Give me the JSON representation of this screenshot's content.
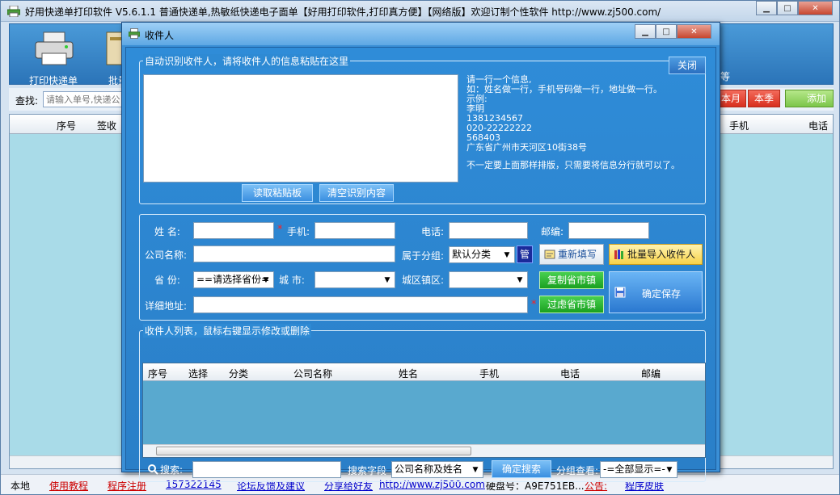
{
  "main_window": {
    "title": "好用快递单打印软件 V5.6.1.1 普通快递单,热敏纸快递电子面单【好用打印软件,打印真方便】【网络版】欢迎订制个性软件  http://www.zj500.com/",
    "min_label": "▁",
    "max_label": "□",
    "close_label": "✕"
  },
  "toolbar": {
    "items": [
      {
        "label": "打印快递单",
        "icon": "printer-icon"
      },
      {
        "label": "批量",
        "icon": "batch-icon"
      }
    ],
    "overflow_label": "等"
  },
  "search_bar": {
    "label": "查找:",
    "placeholder": "请输入单号,快递公",
    "btn_month": "本月",
    "btn_quarter": "本季",
    "btn_add": "添加"
  },
  "main_grid": {
    "columns": [
      "序号",
      "签收",
      "手机",
      "电话"
    ]
  },
  "statusbar": {
    "items": [
      {
        "text": "本地",
        "style": "plain"
      },
      {
        "text": "使用教程",
        "style": "red"
      },
      {
        "text": "程序注册",
        "style": "red"
      },
      {
        "text": "157322145",
        "style": "link"
      },
      {
        "text": "论坛反馈及建议",
        "style": "link"
      },
      {
        "text": "分享给好友",
        "style": "link"
      },
      {
        "text": "http://www.zj500.com",
        "style": "link"
      },
      {
        "text": "硬盘号：A9E751EB...",
        "style": "plain"
      },
      {
        "text": "公告:",
        "style": "red"
      },
      {
        "text": "程序皮肤",
        "style": "link"
      }
    ]
  },
  "dialog": {
    "title": "收件人",
    "recognize_group": {
      "legend": "自动识别收件人，请将收件人的信息粘贴在这里",
      "textarea_value": "",
      "close_btn": "关闭",
      "read_clipboard_btn": "读取粘贴板",
      "clear_btn": "清空识别内容",
      "help_lines": [
        "请一行一个信息,",
        "如：姓名做一行，手机号码做一行，地址做一行。",
        "示例:",
        "李明",
        "1381234567",
        "020-22222222",
        "568403",
        "广东省广州市天河区10街38号",
        "",
        "不一定要上面那样排版，只需要将信息分行就可以了。"
      ]
    },
    "form": {
      "name_label": "姓    名:",
      "name_value": "",
      "mobile_label": "手机:",
      "mobile_value": "",
      "phone_label": "电话:",
      "phone_value": "",
      "zip_label": "邮编:",
      "zip_value": "",
      "company_label": "公司名称:",
      "company_value": "",
      "group_label": "属于分组:",
      "group_value": "默认分类",
      "manage_btn": "管",
      "province_label": "省    份:",
      "province_value": "==请选择省份=",
      "city_label": "城    市:",
      "city_value": "",
      "district_label": "城区镇区:",
      "district_value": "",
      "address_label": "详细地址:",
      "address_value": "",
      "refill_btn": "重新填写",
      "batch_import_btn": "批量导入收件人",
      "copy_province_btn": "复制省市镇",
      "filter_province_btn": "过虑省市镇",
      "save_btn": "确定保存",
      "required_mark": "*"
    },
    "list_group": {
      "legend": "收件人列表，鼠标右键显示修改或删除",
      "columns": [
        "序号",
        "选择",
        "分类",
        "公司名称",
        "姓名",
        "手机",
        "电话",
        "邮编"
      ]
    },
    "bottom": {
      "search_label": "搜索:",
      "search_value": "",
      "field_label": "搜索字段",
      "field_value": "公司名称及姓名",
      "search_btn": "确定搜索",
      "group_view_label": "分组查看:",
      "group_view_value": "-=全部显示=-"
    }
  }
}
